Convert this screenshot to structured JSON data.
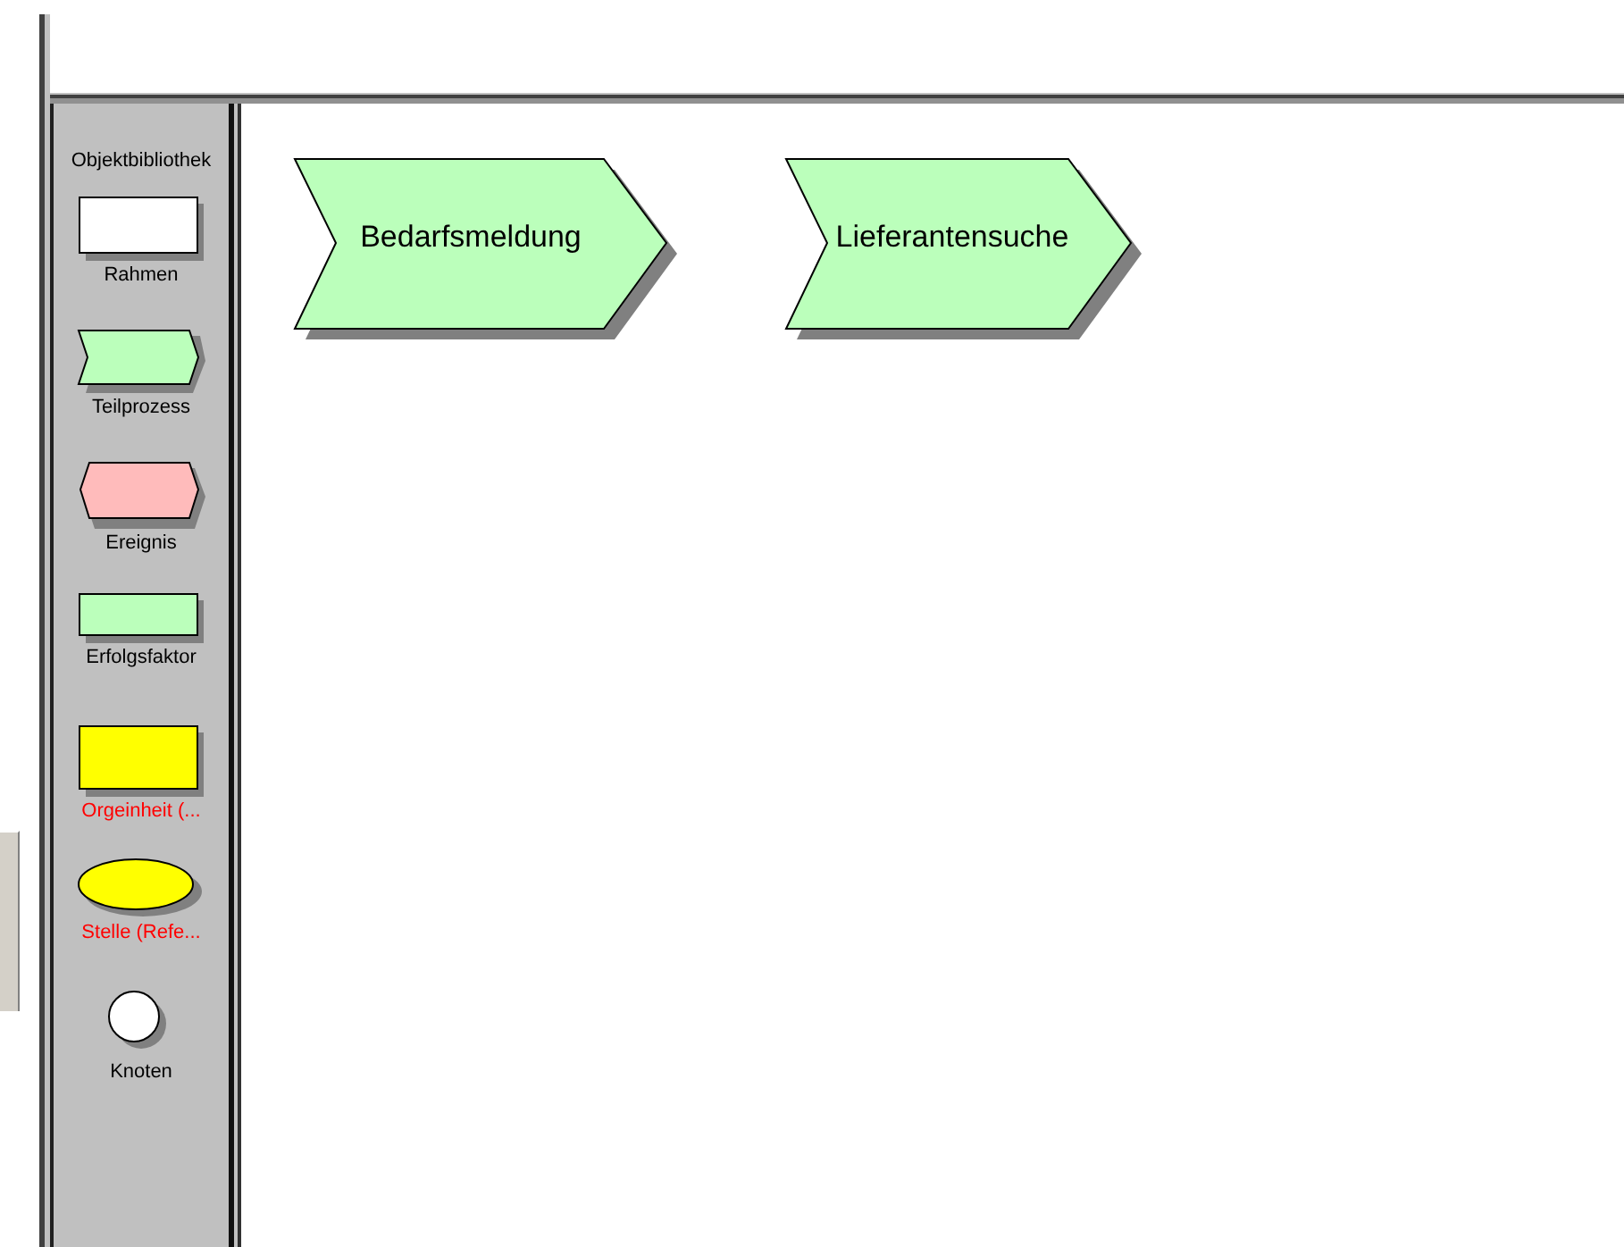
{
  "library": {
    "title": "Objektbibliothek",
    "items": [
      {
        "kind": "rect",
        "color": "#ffffff",
        "label": "Rahmen",
        "marked": false
      },
      {
        "kind": "chevron",
        "color": "#bbffbb",
        "label": "Teilprozess",
        "marked": false
      },
      {
        "kind": "hexagon",
        "color": "#ffbbbb",
        "label": "Ereignis",
        "marked": false
      },
      {
        "kind": "rect-small",
        "color": "#bbffbb",
        "label": "Erfolgsfaktor",
        "marked": false
      },
      {
        "kind": "rect-tall",
        "color": "#ffff00",
        "label": "Orgeinheit (...",
        "marked": true
      },
      {
        "kind": "ellipse",
        "color": "#ffff00",
        "label": "Stelle (Refe...",
        "marked": true
      },
      {
        "kind": "circle",
        "color": "#ffffff",
        "label": "Knoten",
        "marked": false
      }
    ]
  },
  "canvas": {
    "nodes": [
      {
        "kind": "chevron",
        "label": "Bedarfsmeldung"
      },
      {
        "kind": "chevron",
        "label": "Lieferantensuche"
      }
    ]
  }
}
